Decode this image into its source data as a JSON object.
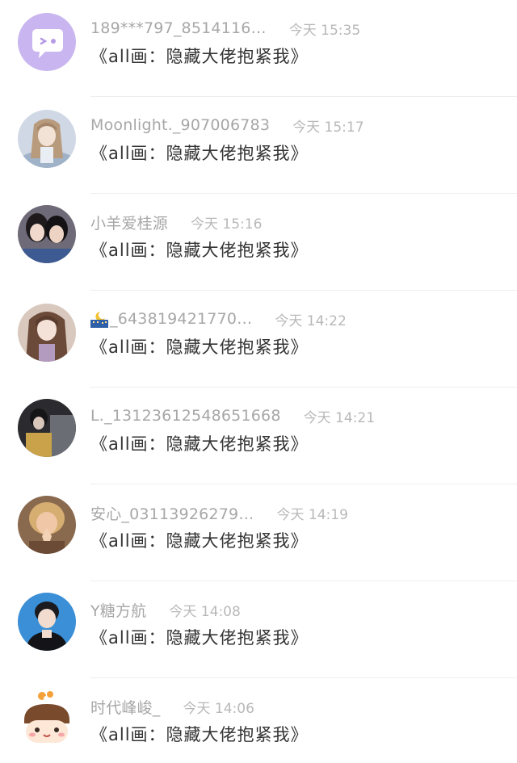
{
  "comments": [
    {
      "username": "189***797_8514116…",
      "time": "今天 15:35",
      "message": "《all画：隐藏大佬抱紧我》",
      "avatar": "chat-bubble-icon"
    },
    {
      "username": "Moonlight._907006783",
      "time": "今天 15:17",
      "message": "《all画：隐藏大佬抱紧我》",
      "avatar": "anime-girl"
    },
    {
      "username": "小羊爱桂源",
      "time": "今天 15:16",
      "message": "《all画：隐藏大佬抱紧我》",
      "avatar": "two-people-selfie"
    },
    {
      "username": "_643819421770…",
      "username_icon": "night-city-icon",
      "time": "今天 14:22",
      "message": "《all画：隐藏大佬抱紧我》",
      "avatar": "illustrated-girl"
    },
    {
      "username": "L._1312361254865​1668",
      "time": "今天 14:21",
      "message": "《all画：隐藏大佬抱紧我》",
      "avatar": "dark-photo"
    },
    {
      "username": "安心_03113926279…",
      "time": "今天 14:19",
      "message": "《all画：隐藏大佬抱紧我》",
      "avatar": "praying-child"
    },
    {
      "username": "Y糖方航",
      "time": "今天 14:08",
      "message": "《all画：隐藏大佬抱紧我》",
      "avatar": "young-man"
    },
    {
      "username": "时代峰峻_",
      "time": "今天 14:06",
      "message": "《all画：隐藏大佬抱紧我》",
      "avatar": "cartoon-face"
    }
  ],
  "colors": {
    "username": "#a7a7a7",
    "time": "#b8b8b8",
    "message": "#333333",
    "divider": "#eeeeee",
    "bubble_avatar_bg": "#c9b6f0"
  }
}
